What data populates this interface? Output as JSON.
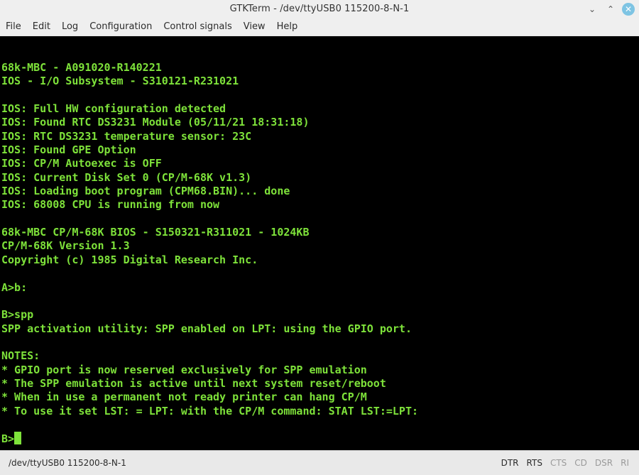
{
  "window": {
    "title": "GTKTerm - /dev/ttyUSB0  115200-8-N-1",
    "minimize_glyph": "⌄",
    "maximize_glyph": "⌃",
    "close_glyph": "✕"
  },
  "menu": [
    "File",
    "Edit",
    "Log",
    "Configuration",
    "Control signals",
    "View",
    "Help"
  ],
  "terminal": {
    "lines": [
      "68k-MBC - A091020-R140221",
      "IOS - I/O Subsystem - S310121-R231021",
      "",
      "IOS: Full HW configuration detected",
      "IOS: Found RTC DS3231 Module (05/11/21 18:31:18)",
      "IOS: RTC DS3231 temperature sensor: 23C",
      "IOS: Found GPE Option",
      "IOS: CP/M Autoexec is OFF",
      "IOS: Current Disk Set 0 (CP/M-68K v1.3)",
      "IOS: Loading boot program (CPM68.BIN)... done",
      "IOS: 68008 CPU is running from now",
      "",
      "68k-MBC CP/M-68K BIOS - S150321-R311021 - 1024KB",
      "CP/M-68K Version 1.3",
      "Copyright (c) 1985 Digital Research Inc.",
      "",
      "A>b:",
      "",
      "B>spp",
      "SPP activation utility: SPP enabled on LPT: using the GPIO port.",
      "",
      "NOTES:",
      "* GPIO port is now reserved exclusively for SPP emulation",
      "* The SPP emulation is active until next system reset/reboot",
      "* When in use a permanent not ready printer can hang CP/M",
      "* To use it set LST: = LPT: with the CP/M command: STAT LST:=LPT:",
      ""
    ],
    "prompt": "B>",
    "text_color": "#7ee23a",
    "background": "#000000"
  },
  "status": {
    "port": "/dev/ttyUSB0  115200-8-N-1",
    "signals": [
      {
        "name": "DTR",
        "active": true
      },
      {
        "name": "RTS",
        "active": true
      },
      {
        "name": "CTS",
        "active": false
      },
      {
        "name": "CD",
        "active": false
      },
      {
        "name": "DSR",
        "active": false
      },
      {
        "name": "RI",
        "active": false
      }
    ]
  }
}
